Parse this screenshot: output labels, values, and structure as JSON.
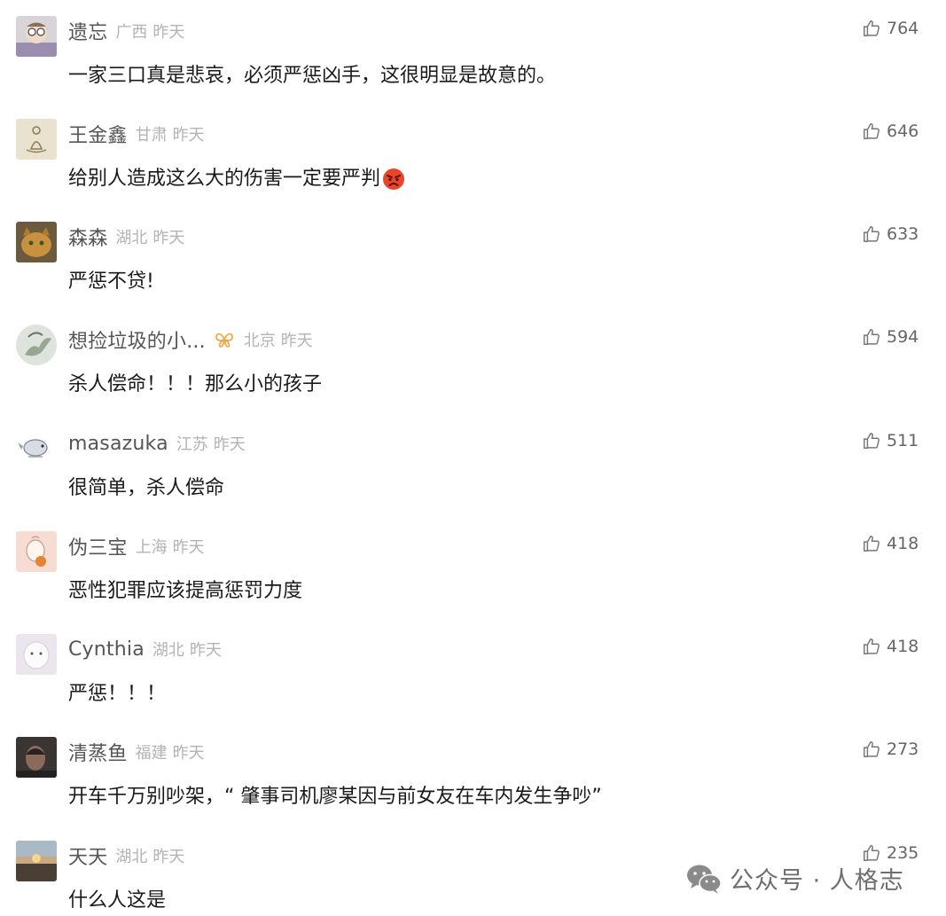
{
  "comments": [
    {
      "username": "遗忘",
      "location": "广西",
      "time": "昨天",
      "text": "一家三口真是悲哀，必须严惩凶手，这很明显是故意的。",
      "likes": "764",
      "avatar": "child-photo"
    },
    {
      "username": "王金鑫",
      "location": "甘肃",
      "time": "昨天",
      "text": "给别人造成这么大的伤害一定要严判",
      "emoji": "angry-face-emoji",
      "likes": "646",
      "avatar": "meditation-figure"
    },
    {
      "username": "森森",
      "location": "湖北",
      "time": "昨天",
      "text": "严惩不贷!",
      "likes": "633",
      "avatar": "cat-photo"
    },
    {
      "username": "想捡垃圾的小...",
      "badge": "butterfly-badge",
      "location": "北京",
      "time": "昨天",
      "text": "杀人偿命！！！那么小的孩子",
      "likes": "594",
      "avatar": "pegasus-illustration"
    },
    {
      "username": "masazuka",
      "location": "江苏",
      "time": "昨天",
      "text": "很简单，杀人偿命",
      "likes": "511",
      "avatar": "bird-illustration"
    },
    {
      "username": "伪三宝",
      "location": "上海",
      "time": "昨天",
      "text": "恶性犯罪应该提高惩罚力度",
      "likes": "418",
      "avatar": "cartoon-character"
    },
    {
      "username": "Cynthia",
      "location": "湖北",
      "time": "昨天",
      "text": "严惩！！！",
      "likes": "418",
      "avatar": "white-dog-photo"
    },
    {
      "username": "清蒸鱼",
      "location": "福建",
      "time": "昨天",
      "text": "开车千万别吵架，“ 肇事司机廖某因与前女友在车内发生争吵”",
      "likes": "273",
      "avatar": "man-portrait"
    },
    {
      "username": "天天",
      "location": "湖北",
      "time": "昨天",
      "text": "什么人这是",
      "likes": "235",
      "avatar": "sunset-photo"
    }
  ],
  "watermark": {
    "text": "公众号 · 人格志",
    "icon": "wechat-icon"
  },
  "colors": {
    "username": "#555555",
    "meta": "#b3b3b3",
    "text": "#1a1a1a",
    "like": "#666666",
    "badge": "#f2a33a",
    "emoji": "#e8452c"
  }
}
